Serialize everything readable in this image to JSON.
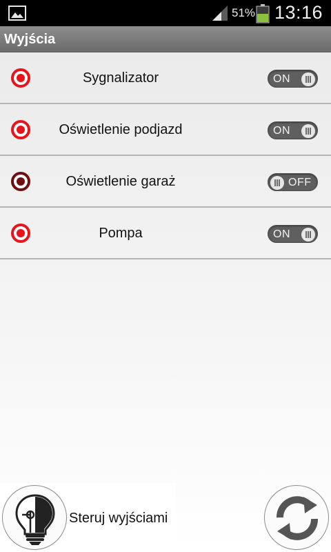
{
  "status_bar": {
    "battery_percent": "51%",
    "battery_level": 0.51,
    "time": "13:16",
    "icons": [
      "gallery-icon",
      "signal-icon",
      "battery-icon"
    ]
  },
  "title_bar": {
    "title": "Wyjścia"
  },
  "outputs": [
    {
      "label": "Sygnalizator",
      "state": "ON",
      "indicator_color": "#e8141c"
    },
    {
      "label": "Oświetlenie podjazd",
      "state": "ON",
      "indicator_color": "#e8141c"
    },
    {
      "label": "Oświetlenie garaż",
      "state": "OFF",
      "indicator_color": "#6e0f10"
    },
    {
      "label": "Pompa",
      "state": "ON",
      "indicator_color": "#e8141c"
    }
  ],
  "bottom": {
    "control_label": "Steruj wyjściami",
    "left_icon": "lightbulb-icon",
    "right_icon": "refresh-icon"
  },
  "colors": {
    "title_bar": "#7c7c7c",
    "indicator_on": "#e8141c",
    "indicator_off": "#6e0f10",
    "toggle_bg": "#5f5f5f"
  }
}
